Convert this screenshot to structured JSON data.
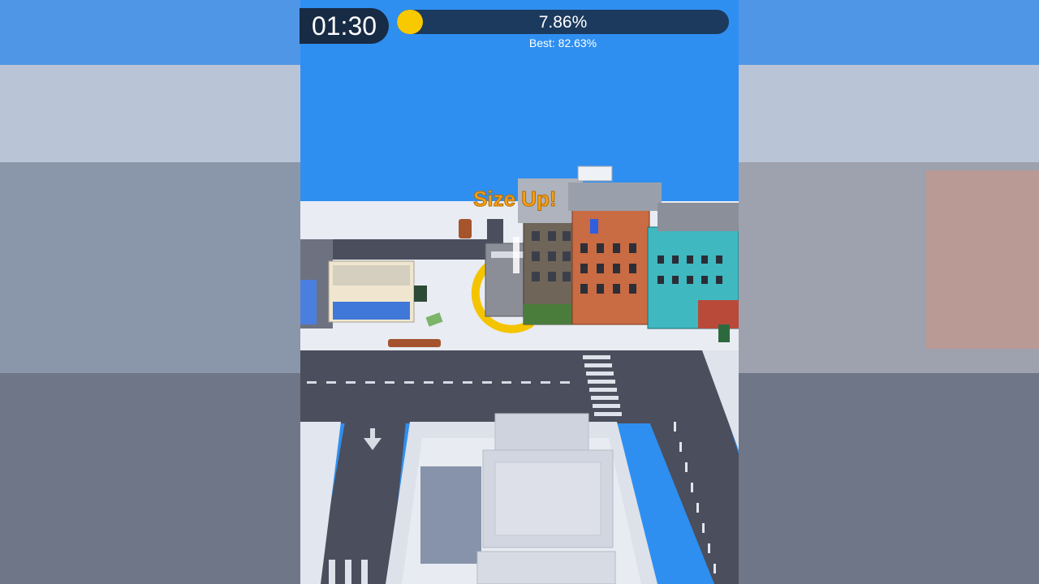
{
  "hud": {
    "timer": "01:30",
    "progress_percent": 7.86,
    "progress_label": "7.86%",
    "best_label": "Best: 82.63%",
    "progress_color": "#f8c800",
    "bar_color": "#1c3a5e"
  },
  "popup": {
    "text": "Size Up!",
    "color": "#f4a11a"
  },
  "scene": {
    "sky_color": "#2f8ff0",
    "road_color": "#4b4e5c",
    "hole_ring_color": "#f5c400"
  }
}
